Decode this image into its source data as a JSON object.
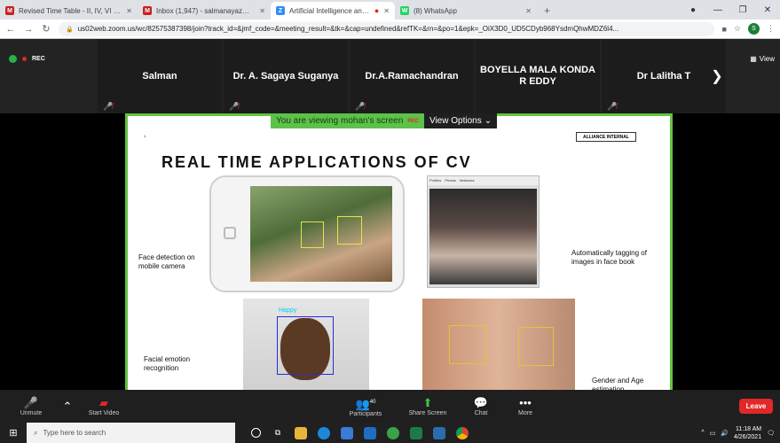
{
  "browser": {
    "tabs": [
      {
        "title": "Revised Time Table - II, IV, VI Sen",
        "favicon": "M",
        "color": "#c5221f"
      },
      {
        "title": "Inbox (1,947) - salmanayaz@gm",
        "favicon": "M",
        "color": "#c5221f"
      },
      {
        "title": "Artificial Intelligence and its",
        "favicon": "Z",
        "color": "#2d8cff"
      },
      {
        "title": "(8) WhatsApp",
        "favicon": "W",
        "color": "#25d366"
      }
    ],
    "url": "us02web.zoom.us/wc/82575387398/join?track_id=&jmf_code=&meeting_result=&tk=&cap=undefined&refTK=&rn=&po=1&epk=_OiX3D0_UD5CDyb968YsdmQhwMDZ6l4...",
    "profile_initial": "S"
  },
  "meeting": {
    "rec_label": "REC",
    "participants": [
      {
        "name": "Salman"
      },
      {
        "name": "Dr. A. Sagaya Suganya"
      },
      {
        "name": "Dr.A.Ramachandran"
      },
      {
        "name": "BOYELLA MALA KONDA R EDDY"
      },
      {
        "name": "Dr Lalitha T"
      }
    ],
    "view_label": "View",
    "banner_text": "You are viewing mohan's screen",
    "banner_rec": "REC",
    "view_options": "View Options"
  },
  "slide": {
    "badge": "ALLIANCE INTERNAL",
    "title": "REAL TIME APPLICATIONS OF CV",
    "labels": {
      "face_detection": "Face detection on mobile camera",
      "tagging": "Automatically tagging of images in face book",
      "emotion": "Facial emotion recognition",
      "gender_age": "Gender and Age estimation"
    },
    "fb_tabs": [
      "Profiles",
      "Photos",
      "Networks"
    ],
    "emotion_tag": "Happy"
  },
  "toolbar": {
    "unmute": "Unmute",
    "start_video": "Start Video",
    "participants": "Participants",
    "participants_count": "40",
    "share_screen": "Share Screen",
    "chat": "Chat",
    "more": "More",
    "leave": "Leave"
  },
  "taskbar": {
    "search_placeholder": "Type here to search",
    "time": "11:18 AM",
    "date": "4/26/2021"
  }
}
